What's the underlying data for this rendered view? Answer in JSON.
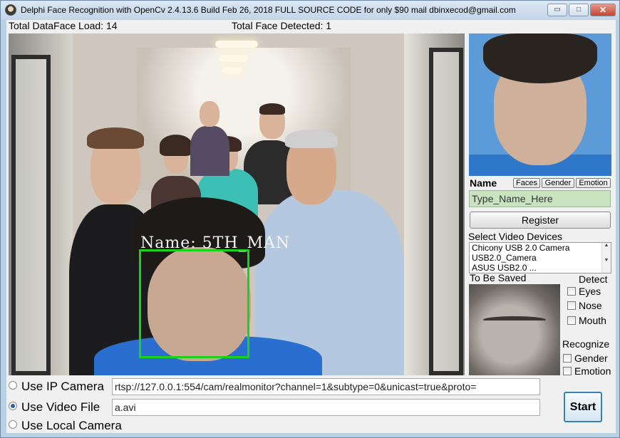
{
  "window": {
    "title": "Delphi Face Recognition with OpenCv 2.4.13.6 Build Feb 26, 2018 FULL SOURCE CODE for only $90 mail dbinxecod@gmail.com",
    "min_glyph": "▭",
    "max_glyph": "□",
    "close_glyph": "✕"
  },
  "stats": {
    "total_load": "Total DataFace Load:  14",
    "total_detected": "Total Face Detected:  1"
  },
  "video": {
    "face_label": "Name: 5TH_MAN",
    "box_color": "#1bd21b"
  },
  "panel": {
    "name_label": "Name",
    "faces_btn": "Faces",
    "gender_btn": "Gender",
    "emotion_btn": "Emotion",
    "name_input_value": "Type_Name_Here",
    "register_label": "Register",
    "select_devices_label": "Select Video Devices",
    "devices": [
      "Chicony USB 2.0 Camera",
      "USB2.0_Camera",
      "ASUS USB2.0 ..."
    ],
    "to_be_saved_label": "To Be Saved",
    "detect_label": "Detect",
    "detect_options": [
      "Eyes",
      "Nose",
      "Mouth"
    ],
    "recognize_label": "Recognize",
    "recognize_options": [
      "Gender",
      "Emotion"
    ]
  },
  "source": {
    "ip_label": "Use IP Camera",
    "ip_value": "rtsp://127.0.0.1:554/cam/realmonitor?channel=1&subtype=0&unicast=true&proto=",
    "video_label": "Use Video File",
    "video_value": "a.avi",
    "local_label": "Use Local Camera",
    "selected": "video",
    "start_label": "Start"
  }
}
